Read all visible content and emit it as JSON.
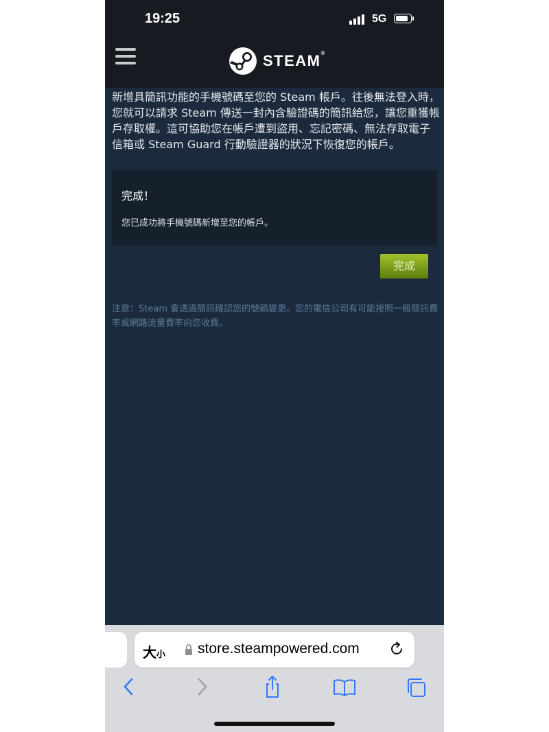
{
  "status_bar": {
    "time": "19:25",
    "network": "5G"
  },
  "header": {
    "logo_text": "STEAM",
    "logo_reg": "®"
  },
  "main": {
    "intro_text": "新增具簡訊功能的手機號碼至您的 Steam 帳戶。往後無法登入時，您就可以請求 Steam 傳送一封內含驗證碼的簡訊給您，讓您重獲帳戶存取權。這可協助您在帳戶遭到盜用、忘記密碼、無法存取電子信箱或 Steam Guard 行動驗證器的狀況下恢復您的帳戶。",
    "panel_title": "完成！",
    "panel_message": "您已成功將手機號碼新增至您的帳戶。",
    "done_button": "完成",
    "note": "注意：Steam 會透過簡訊確認您的號碼變更。您的電信公司有可能按照一般簡訊費率或網路流量費率向您收費。"
  },
  "browser": {
    "text_size_big": "大",
    "text_size_small": "小",
    "url": "store.steampowered.com"
  },
  "colors": {
    "steam_header": "#171a21",
    "page_bg": "#1c2a3d",
    "accent_green": "#a4c22a",
    "ios_blue": "#3478f6"
  }
}
